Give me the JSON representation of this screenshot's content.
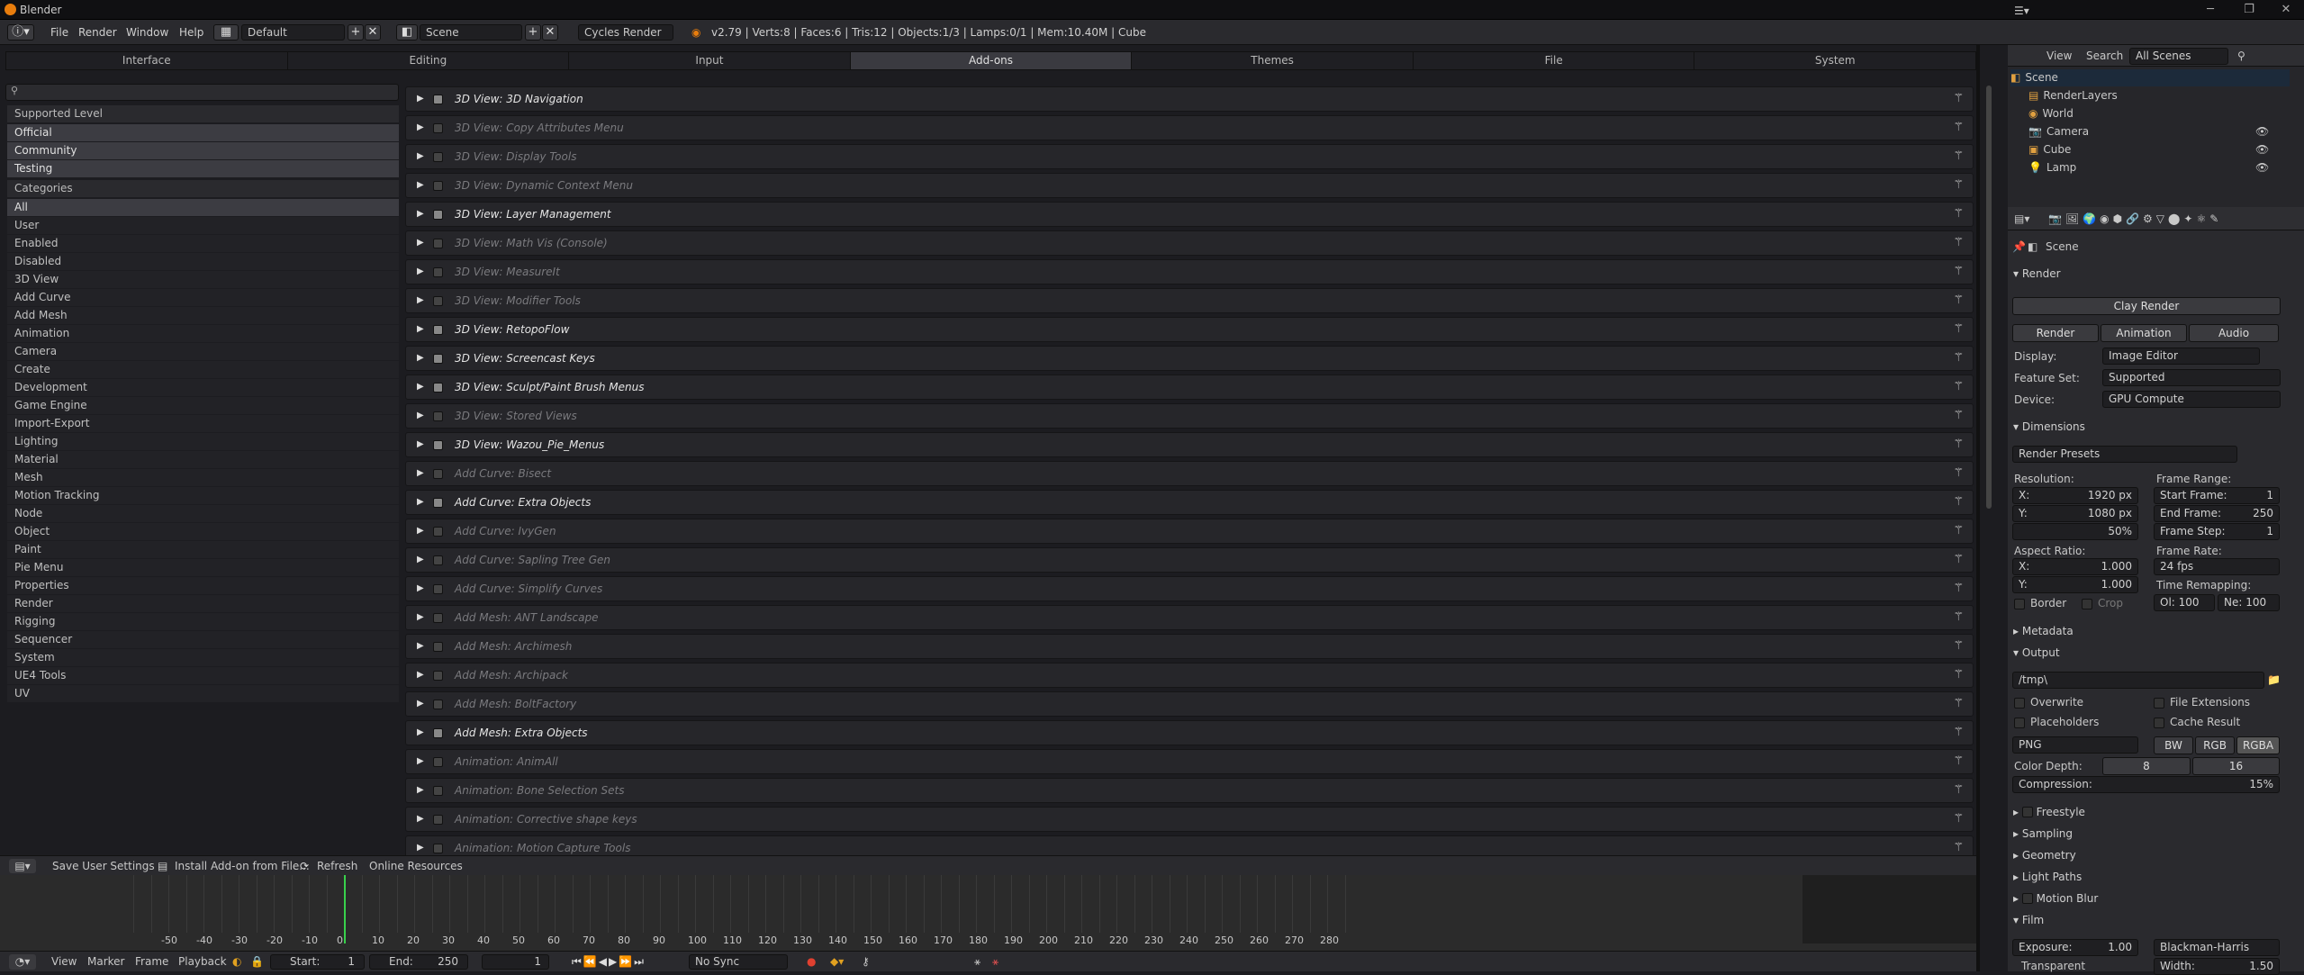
{
  "app": {
    "title": "Blender"
  },
  "colors": {
    "accent": "#e87d0d",
    "cursor": "#38d04c",
    "panel": "#26262a"
  },
  "menu": {
    "file": "File",
    "render": "Render",
    "window": "Window",
    "help": "Help"
  },
  "layout_name": "Default",
  "scene_name": "Scene",
  "engine": "Cycles Render",
  "stats": "v2.79 | Verts:8 | Faces:6 | Tris:12 | Objects:1/3 | Lamps:0/1 | Mem:10.40M | Cube",
  "prefs_tabs": [
    {
      "label": "Interface"
    },
    {
      "label": "Editing"
    },
    {
      "label": "Input"
    },
    {
      "label": "Add-ons"
    },
    {
      "label": "Themes"
    },
    {
      "label": "File"
    },
    {
      "label": "System"
    }
  ],
  "left": {
    "supported_level": "Supported Level",
    "levels": [
      "Official",
      "Community",
      "Testing"
    ],
    "categories_label": "Categories",
    "categories": [
      "All",
      "User",
      "Enabled",
      "Disabled",
      "3D View",
      "Add Curve",
      "Add Mesh",
      "Animation",
      "Camera",
      "Create",
      "Development",
      "Game Engine",
      "Import-Export",
      "Lighting",
      "Material",
      "Mesh",
      "Motion Tracking",
      "Node",
      "Object",
      "Paint",
      "Pie Menu",
      "Properties",
      "Render",
      "Rigging",
      "Sequencer",
      "System",
      "UE4 Tools",
      "UV"
    ]
  },
  "addons": [
    {
      "name": "3D View: 3D Navigation",
      "enabled": true
    },
    {
      "name": "3D View: Copy Attributes Menu",
      "enabled": false
    },
    {
      "name": "3D View: Display Tools",
      "enabled": false
    },
    {
      "name": "3D View: Dynamic Context Menu",
      "enabled": false
    },
    {
      "name": "3D View: Layer Management",
      "enabled": true
    },
    {
      "name": "3D View: Math Vis (Console)",
      "enabled": false
    },
    {
      "name": "3D View: MeasureIt",
      "enabled": false
    },
    {
      "name": "3D View: Modifier Tools",
      "enabled": false
    },
    {
      "name": "3D View: RetopoFlow",
      "enabled": true
    },
    {
      "name": "3D View: Screencast Keys",
      "enabled": true
    },
    {
      "name": "3D View: Sculpt/Paint Brush Menus",
      "enabled": true
    },
    {
      "name": "3D View: Stored Views",
      "enabled": false
    },
    {
      "name": "3D View: Wazou_Pie_Menus",
      "enabled": true
    },
    {
      "name": "Add Curve: Bisect",
      "enabled": false
    },
    {
      "name": "Add Curve: Extra Objects",
      "enabled": true
    },
    {
      "name": "Add Curve: IvyGen",
      "enabled": false
    },
    {
      "name": "Add Curve: Sapling Tree Gen",
      "enabled": false
    },
    {
      "name": "Add Curve: Simplify Curves",
      "enabled": false
    },
    {
      "name": "Add Mesh: ANT Landscape",
      "enabled": false
    },
    {
      "name": "Add Mesh: Archimesh",
      "enabled": false
    },
    {
      "name": "Add Mesh: Archipack",
      "enabled": false
    },
    {
      "name": "Add Mesh: BoltFactory",
      "enabled": false
    },
    {
      "name": "Add Mesh: Extra Objects",
      "enabled": true
    },
    {
      "name": "Animation: AnimAll",
      "enabled": false
    },
    {
      "name": "Animation: Bone Selection Sets",
      "enabled": false
    },
    {
      "name": "Animation: Corrective shape keys",
      "enabled": false
    },
    {
      "name": "Animation: Motion Capture Tools",
      "enabled": false
    }
  ],
  "bottom": {
    "save": "Save User Settings",
    "install": "Install Add-on from File...",
    "refresh": "Refresh",
    "online": "Online Resources"
  },
  "timeline": {
    "ticks": [
      "-50",
      "-40",
      "-30",
      "-20",
      "-10",
      "0",
      "10",
      "20",
      "30",
      "40",
      "50",
      "60",
      "70",
      "80",
      "90",
      "100",
      "110",
      "120",
      "130",
      "140",
      "150",
      "160",
      "170",
      "180",
      "190",
      "200",
      "210",
      "220",
      "230",
      "240",
      "250",
      "260",
      "270",
      "280"
    ],
    "current_frame": "1",
    "view": "View",
    "marker": "Marker",
    "frame": "Frame",
    "playback": "Playback",
    "start_label": "Start:",
    "start": "1",
    "end_label": "End:",
    "end": "250",
    "sync": "No Sync"
  },
  "outliner": {
    "view": "View",
    "search": "Search",
    "filter": "All Scenes",
    "items": [
      {
        "label": "Scene"
      },
      {
        "label": "RenderLayers"
      },
      {
        "label": "World"
      },
      {
        "label": "Camera"
      },
      {
        "label": "Cube"
      },
      {
        "label": "Lamp"
      }
    ]
  },
  "props": {
    "scene": "Scene",
    "render_section": "Render",
    "clay_render": "Clay Render",
    "render_btn": "Render",
    "animation_btn": "Animation",
    "audio_btn": "Audio",
    "display_label": "Display:",
    "display": "Image Editor",
    "feature_label": "Feature Set:",
    "feature": "Supported",
    "device_label": "Device:",
    "device": "GPU Compute",
    "dimensions": "Dimensions",
    "render_presets": "Render Presets",
    "resolution": "Resolution:",
    "res_x_label": "X:",
    "res_x": "1920 px",
    "res_y_label": "Y:",
    "res_y": "1080 px",
    "res_pct": "50%",
    "frame_range": "Frame Range:",
    "start_frame_label": "Start Frame:",
    "start_frame": "1",
    "end_frame_label": "End Frame:",
    "end_frame": "250",
    "frame_step_label": "Frame Step:",
    "frame_step": "1",
    "aspect": "Aspect Ratio:",
    "asp_x_label": "X:",
    "asp_x": "1.000",
    "asp_y_label": "Y:",
    "asp_y": "1.000",
    "frame_rate": "Frame Rate:",
    "fps": "24 fps",
    "time_remap": "Time Remapping:",
    "old": "Ol: 100",
    "new": "Ne: 100",
    "border": "Border",
    "crop": "Crop",
    "metadata": "Metadata",
    "output": "Output",
    "path": "/tmp\\",
    "overwrite": "Overwrite",
    "file_ext": "File Extensions",
    "placeholders": "Placeholders",
    "cache_result": "Cache Result",
    "format": "PNG",
    "bw": "BW",
    "rgb": "RGB",
    "rgba": "RGBA",
    "color_depth": "Color Depth:",
    "depth8": "8",
    "depth16": "16",
    "compression_label": "Compression:",
    "compression": "15%",
    "freestyle": "Freestyle",
    "sampling": "Sampling",
    "geometry": "Geometry",
    "light_paths": "Light Paths",
    "motion_blur": "Motion Blur",
    "film": "Film",
    "exposure_label": "Exposure:",
    "exposure": "1.00",
    "filter": "Blackman-Harris",
    "transparent": "Transparent",
    "width_label": "Width:",
    "width": "1.50"
  }
}
